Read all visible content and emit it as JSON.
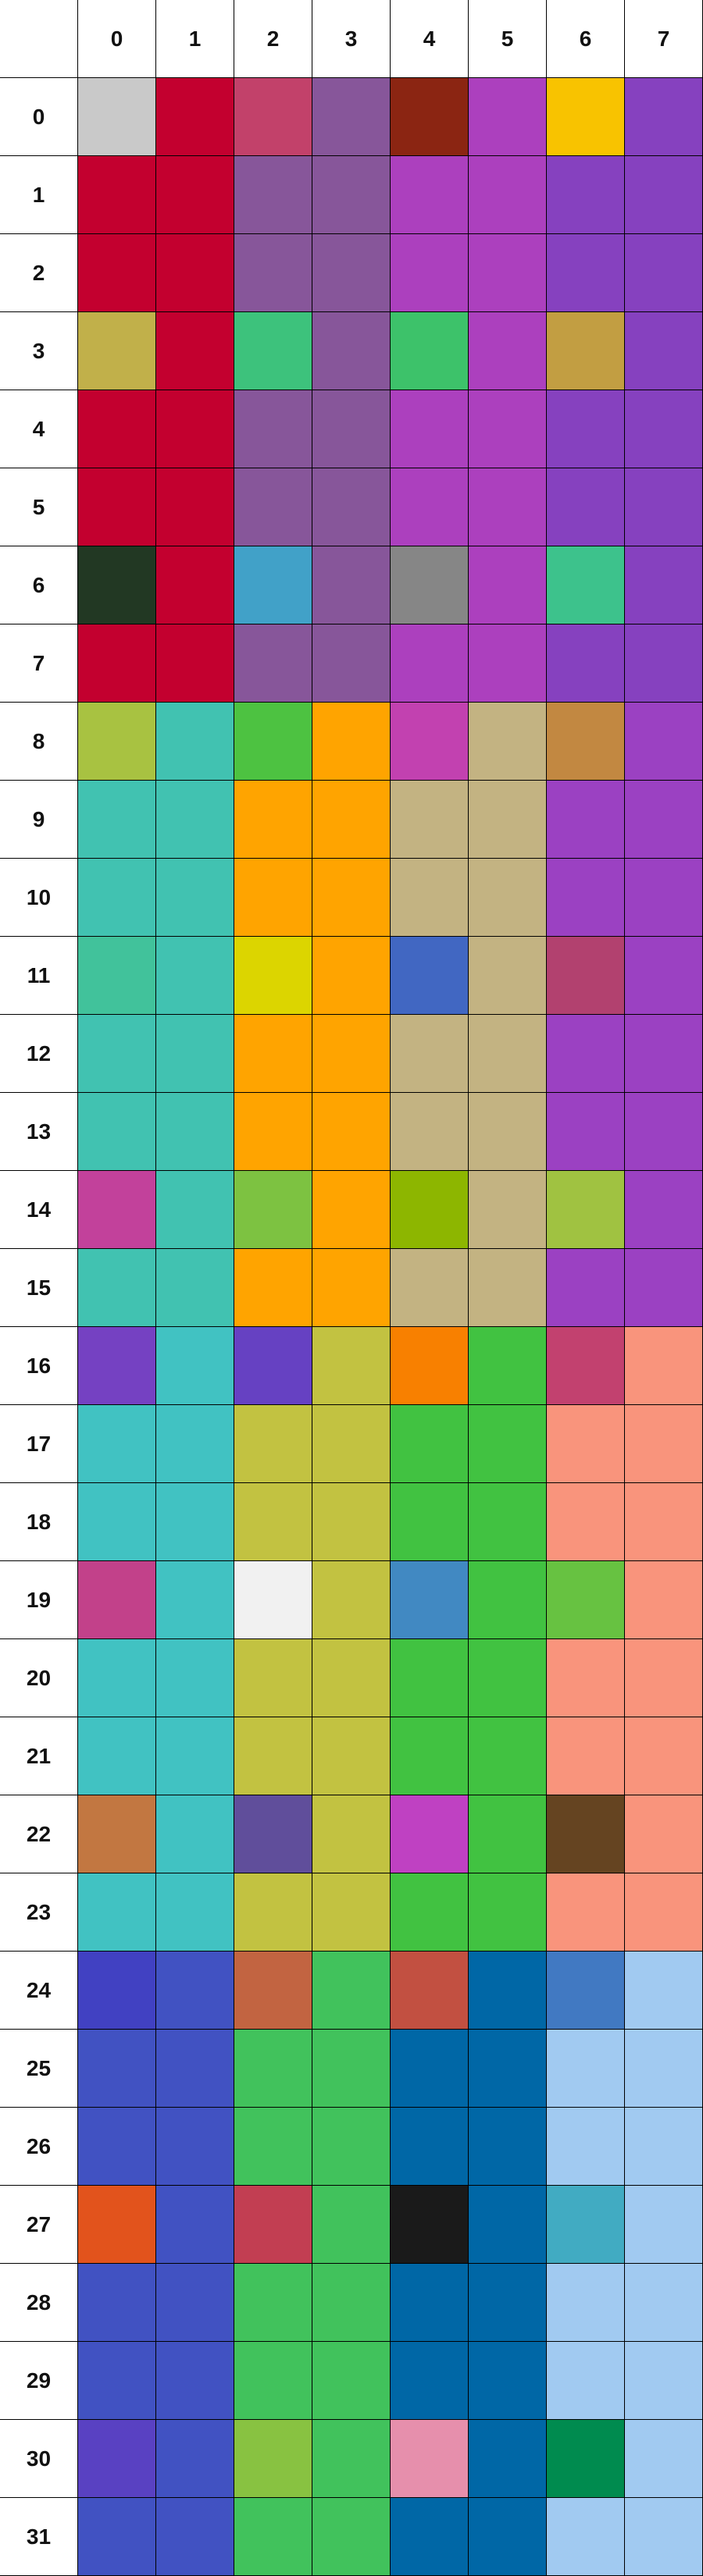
{
  "board": {
    "column_labels": [
      "0",
      "1",
      "2",
      "3",
      "4",
      "5",
      "6",
      "7"
    ],
    "row_labels": [
      "0",
      "1",
      "2",
      "3",
      "4",
      "5",
      "6",
      "7",
      "8",
      "9",
      "10",
      "11",
      "12",
      "13",
      "14",
      "15",
      "16",
      "17",
      "18",
      "19",
      "20",
      "21",
      "22",
      "23",
      "24",
      "25",
      "26",
      "27",
      "28",
      "29",
      "30",
      "31"
    ],
    "cells": [
      [
        "#c9c9c9",
        "#c3002f",
        "#c2416a",
        "#87569a",
        "#8b2512",
        "#ac40be",
        "#f8c300",
        "#8641bf"
      ],
      [
        "#c3002f",
        "#c3002f",
        "#87569a",
        "#87569a",
        "#ac40be",
        "#ac40be",
        "#8641bf",
        "#8641bf"
      ],
      [
        "#c3002f",
        "#c3002f",
        "#87569a",
        "#87569a",
        "#ac40be",
        "#ac40be",
        "#8641bf",
        "#8641bf"
      ],
      [
        "#c1b04a",
        "#c3002f",
        "#3dc27c",
        "#87569a",
        "#3dc26a",
        "#ac40be",
        "#c29e42",
        "#8641bf"
      ],
      [
        "#c3002f",
        "#c3002f",
        "#87569a",
        "#87569a",
        "#ac40be",
        "#ac40be",
        "#8641bf",
        "#8641bf"
      ],
      [
        "#c3002f",
        "#c3002f",
        "#87569a",
        "#87569a",
        "#ac40be",
        "#ac40be",
        "#8641bf",
        "#8641bf"
      ],
      [
        "#223823",
        "#c3002f",
        "#41a1c8",
        "#87569a",
        "#868686",
        "#ac40be",
        "#3dc28c",
        "#8641bf"
      ],
      [
        "#c3002f",
        "#c3002f",
        "#87569a",
        "#87569a",
        "#ac40be",
        "#ac40be",
        "#8641bf",
        "#8641bf"
      ],
      [
        "#a8c241",
        "#41c2b1",
        "#4dc241",
        "#ffa400",
        "#c241b0",
        "#c3b382",
        "#c28841",
        "#9b41c2"
      ],
      [
        "#41c2b1",
        "#41c2b1",
        "#ffa400",
        "#ffa400",
        "#c3b382",
        "#c3b382",
        "#9b41c2",
        "#9b41c2"
      ],
      [
        "#41c2b1",
        "#41c2b1",
        "#ffa400",
        "#ffa400",
        "#c3b382",
        "#c3b382",
        "#9b41c2",
        "#9b41c2"
      ],
      [
        "#41c29b",
        "#41c2b1",
        "#dcd500",
        "#ffa400",
        "#4167c2",
        "#c3b382",
        "#b2416f",
        "#9b41c2"
      ],
      [
        "#41c2b1",
        "#41c2b1",
        "#ffa400",
        "#ffa400",
        "#c3b382",
        "#c3b382",
        "#9b41c2",
        "#9b41c2"
      ],
      [
        "#41c2b1",
        "#41c2b1",
        "#ffa400",
        "#ffa400",
        "#c3b382",
        "#c3b382",
        "#9b41c2",
        "#9b41c2"
      ],
      [
        "#c2419b",
        "#41c2b1",
        "#7dc241",
        "#ffa400",
        "#8db600",
        "#c3b382",
        "#a0c241",
        "#9b41c2"
      ],
      [
        "#41c2b1",
        "#41c2b1",
        "#ffa400",
        "#ffa400",
        "#c3b382",
        "#c3b382",
        "#9b41c2",
        "#9b41c2"
      ],
      [
        "#7541c2",
        "#41c2c2",
        "#6641c2",
        "#c2c241",
        "#f88000",
        "#41c241",
        "#c2416f",
        "#f9947c"
      ],
      [
        "#41c2c2",
        "#41c2c2",
        "#c2c241",
        "#c2c241",
        "#41c241",
        "#41c241",
        "#f9947c",
        "#f9947c"
      ],
      [
        "#41c2c2",
        "#41c2c2",
        "#c2c241",
        "#c2c241",
        "#41c241",
        "#41c241",
        "#f9947c",
        "#f9947c"
      ],
      [
        "#c2418a",
        "#41c2c2",
        "#f1f1f1",
        "#c2c241",
        "#4189c2",
        "#41c241",
        "#67c241",
        "#f9947c"
      ],
      [
        "#41c2c2",
        "#41c2c2",
        "#c2c241",
        "#c2c241",
        "#41c241",
        "#41c241",
        "#f9947c",
        "#f9947c"
      ],
      [
        "#41c2c2",
        "#41c2c2",
        "#c2c241",
        "#c2c241",
        "#41c241",
        "#41c241",
        "#f9947c",
        "#f9947c"
      ],
      [
        "#c27741",
        "#41c2c2",
        "#604e9b",
        "#c2c241",
        "#bf41c2",
        "#41c241",
        "#654421",
        "#f9947c"
      ],
      [
        "#41c2c2",
        "#41c2c2",
        "#c2c241",
        "#c2c241",
        "#41c241",
        "#41c241",
        "#f9947c",
        "#f9947c"
      ],
      [
        "#4141c2",
        "#4152c2",
        "#c26441",
        "#41c25c",
        "#c25041",
        "#0067a6",
        "#4179c2",
        "#a1caf1"
      ],
      [
        "#4152c2",
        "#4152c2",
        "#41c25c",
        "#41c25c",
        "#0067a6",
        "#0067a6",
        "#a1caf1",
        "#a1caf1"
      ],
      [
        "#4152c2",
        "#4152c2",
        "#41c25c",
        "#41c25c",
        "#0067a6",
        "#0067a6",
        "#a1caf1",
        "#a1caf1"
      ],
      [
        "#e2531c",
        "#4152c2",
        "#c23e52",
        "#41c25c",
        "#1a1a1a",
        "#0067a6",
        "#41abc2",
        "#a1caf1"
      ],
      [
        "#4152c2",
        "#4152c2",
        "#41c25c",
        "#41c25c",
        "#0067a6",
        "#0067a6",
        "#a1caf1",
        "#a1caf1"
      ],
      [
        "#4152c2",
        "#4152c2",
        "#41c25c",
        "#41c25c",
        "#0067a6",
        "#0067a6",
        "#a1caf1",
        "#a1caf1"
      ],
      [
        "#5941c2",
        "#4152c2",
        "#88c241",
        "#41c25c",
        "#e68fac",
        "#0067a6",
        "#008b4f",
        "#a1caf1"
      ],
      [
        "#4152c2",
        "#4152c2",
        "#41c25c",
        "#41c25c",
        "#0067a6",
        "#0067a6",
        "#a1caf1",
        "#a1caf1"
      ]
    ]
  }
}
